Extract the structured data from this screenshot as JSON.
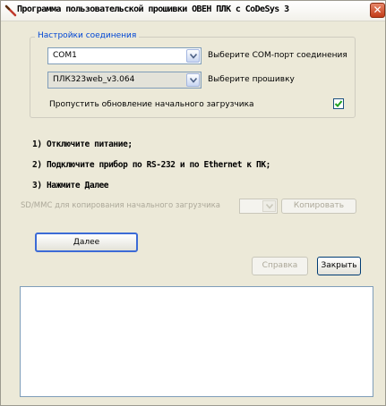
{
  "window": {
    "title": "Программа пользовательской прошивки ОВЕН ПЛК с CoDeSys 3",
    "close_glyph": "✕"
  },
  "connection": {
    "group_title": "Настройки соединения",
    "com_port": {
      "value": "COM1",
      "label": "Выберите COM-порт соединения"
    },
    "firmware": {
      "value": "ПЛК323web_v3.064",
      "label": "Выберите прошивку"
    },
    "skip_bootloader": {
      "label": "Пропустить обновление начального загрузчика",
      "checked": true
    }
  },
  "steps": [
    "1) Отключите питание;",
    "2) Подключите прибор по RS-232 и по Ethernet к ПК;",
    "3) Нажмите Далее"
  ],
  "sdmmc": {
    "label": "SD/MMC для копирования начального загрузчика",
    "copy_button": "Копировать"
  },
  "buttons": {
    "next": "Далее",
    "help": "Справка",
    "close": "Закрыть"
  },
  "output_log": ""
}
